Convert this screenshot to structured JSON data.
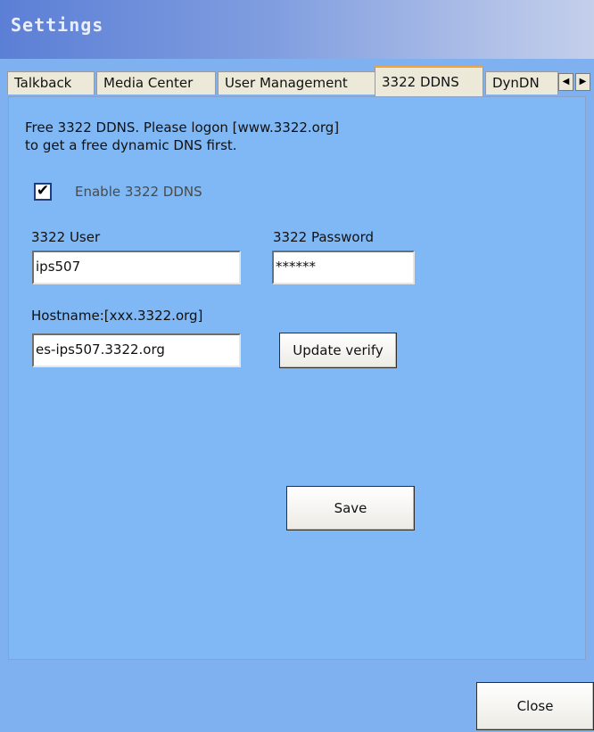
{
  "window": {
    "title": "Settings"
  },
  "tabs": [
    {
      "label": "Talkback"
    },
    {
      "label": "Media Center"
    },
    {
      "label": "User Management"
    },
    {
      "label": "3322 DDNS"
    },
    {
      "label": "DynDN"
    }
  ],
  "tab_scroll": {
    "left": "◀",
    "right": "▶"
  },
  "ddns": {
    "info_line1": "Free 3322 DDNS. Please logon [www.3322.org]",
    "info_line2": "to get a free dynamic DNS first.",
    "enable_label": "Enable 3322 DDNS",
    "enabled": true,
    "check_glyph": "✔",
    "user_label": "3322 User",
    "user_value": "ips507",
    "password_label": "3322 Password",
    "password_value": "******",
    "hostname_label": "Hostname:[xxx.3322.org]",
    "hostname_value": "es-ips507.3322.org",
    "update_button": "Update verify",
    "save_button": "Save"
  },
  "footer": {
    "close_button": "Close"
  },
  "colors": {
    "panel": "#7fb8f4",
    "active_tab_accent": "#f2a33a",
    "titlebar": "#5c7fd6"
  }
}
